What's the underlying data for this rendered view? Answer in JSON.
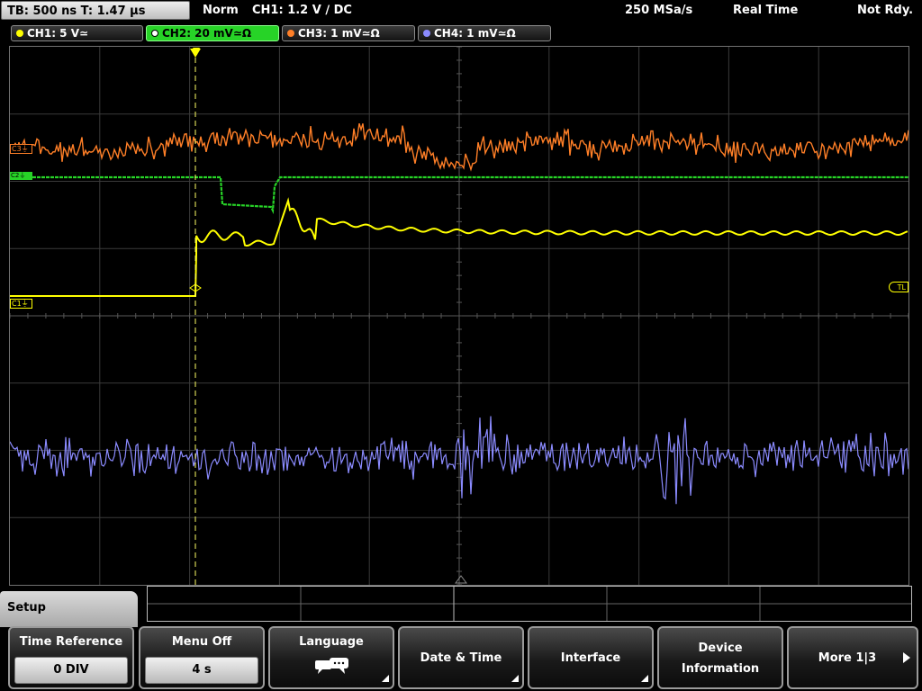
{
  "topbar": {
    "timebase": "TB: 500 ns   T: 1.47 µs",
    "trigger_mode": "Norm",
    "trigger_info": "CH1: 1.2 V ∕ DC",
    "sample_rate": "250 MSa/s",
    "acq_mode": "Real Time",
    "status": "Not Rdy."
  },
  "channels": [
    {
      "label": "CH1: 5 V≃",
      "color": "#ffff00"
    },
    {
      "label": "CH2: 20 mV≃Ω",
      "color": "#27d327"
    },
    {
      "label": "CH3: 1 mV≃Ω",
      "color": "#ff7f27"
    },
    {
      "label": "CH4: 1 mV≃Ω",
      "color": "#8b8bff"
    }
  ],
  "markers": {
    "c3": "C3⏚",
    "c2": "C2⏚",
    "c1": "C1⏚",
    "trigger_level": "TL",
    "trigger_pos": "T"
  },
  "menu": {
    "title": "Setup",
    "softkeys": [
      {
        "label": "Time Reference",
        "value": "0 DIV"
      },
      {
        "label": "Menu Off",
        "value": "4 s"
      },
      {
        "label": "Language",
        "icon": "speech-bubble-icon"
      },
      {
        "label": "Date & Time"
      },
      {
        "label": "Interface"
      },
      {
        "label_line1": "Device",
        "label_line2": "Information"
      },
      {
        "label": "More 1|3"
      }
    ]
  }
}
